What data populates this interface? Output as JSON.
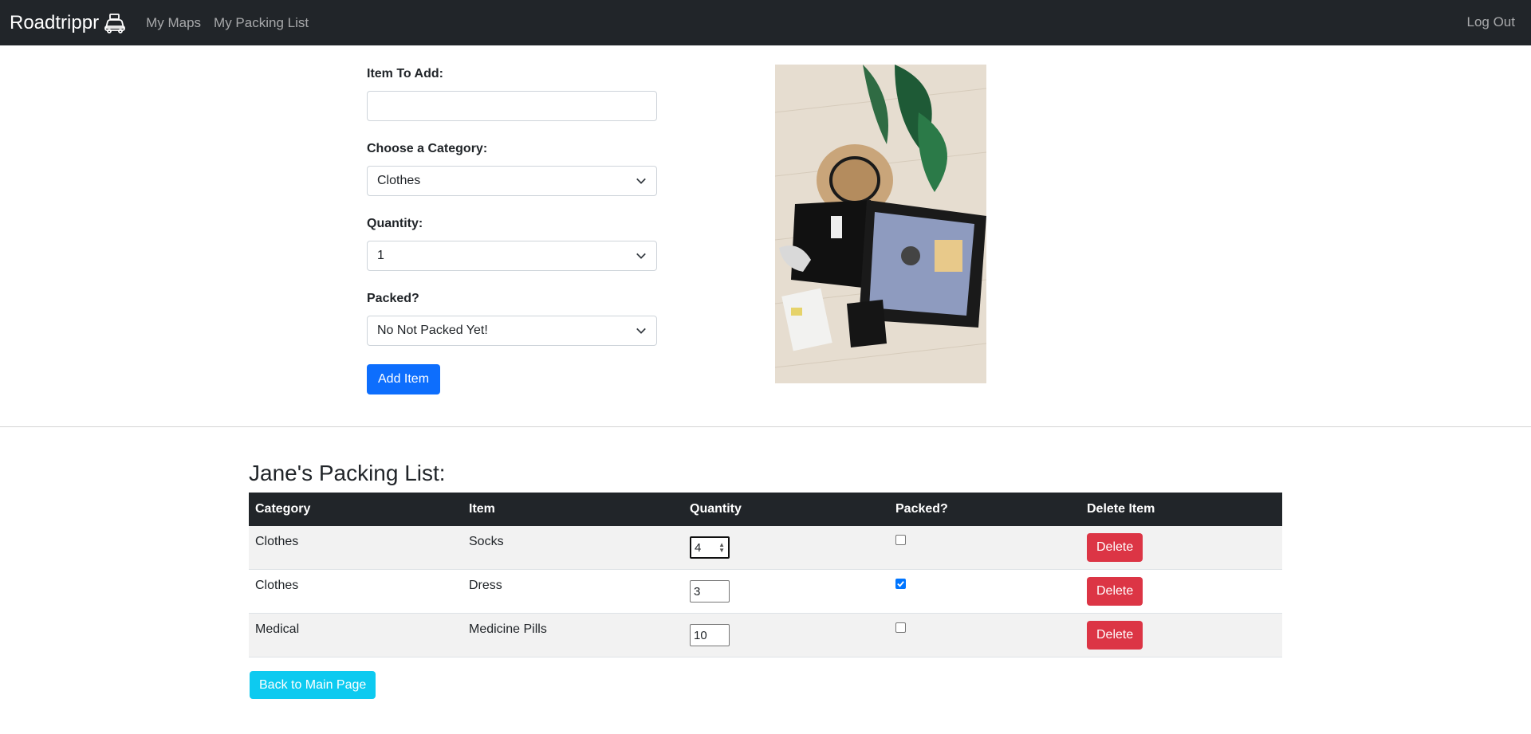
{
  "nav": {
    "brand": "Roadtrippr",
    "brand_icon": "car-luggage-icon",
    "links": [
      "My Maps",
      "My Packing List"
    ],
    "logout": "Log Out"
  },
  "form": {
    "item_label": "Item To Add:",
    "item_value": "",
    "category_label": "Choose a Category:",
    "category_value": "Clothes",
    "quantity_label": "Quantity:",
    "quantity_value": "1",
    "packed_label": "Packed?",
    "packed_value": "No Not Packed Yet!",
    "add_button": "Add Item"
  },
  "photo": {
    "subject": "suitcase-with-hat-and-plant"
  },
  "list": {
    "title": "Jane's Packing List:",
    "headers": [
      "Category",
      "Item",
      "Quantity",
      "Packed?",
      "Delete Item"
    ],
    "rows": [
      {
        "category": "Clothes",
        "item": "Socks",
        "quantity": "4",
        "packed": false,
        "delete": "Delete"
      },
      {
        "category": "Clothes",
        "item": "Dress",
        "quantity": "3",
        "packed": true,
        "delete": "Delete"
      },
      {
        "category": "Medical",
        "item": "Medicine Pills",
        "quantity": "10",
        "packed": false,
        "delete": "Delete"
      }
    ]
  },
  "back_button": "Back to Main Page",
  "colors": {
    "navbar": "#212529",
    "primary": "#0d6efd",
    "danger": "#dc3545",
    "info": "#0dcaf0",
    "checkbox": "#0075ff"
  }
}
